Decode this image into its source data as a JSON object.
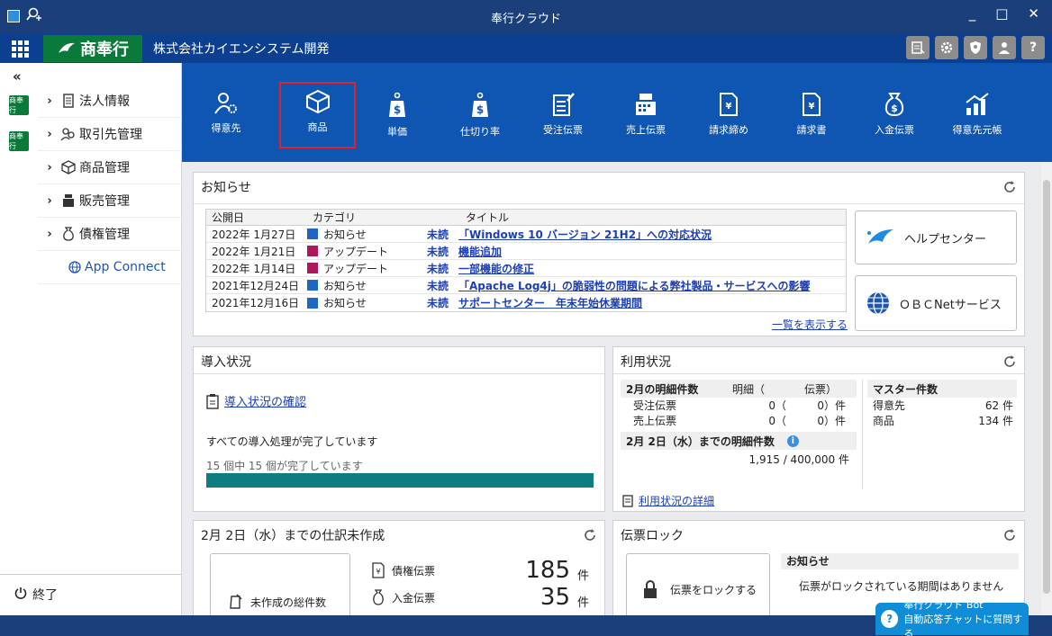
{
  "window": {
    "title": "奉行クラウド"
  },
  "header": {
    "brand": "商奉行",
    "company": "株式会社カイエンシステム開発"
  },
  "sidebar": {
    "apps": [
      {
        "label": "商奉行"
      },
      {
        "label": "商奉行"
      }
    ],
    "items": [
      {
        "label": "法人情報"
      },
      {
        "label": "取引先管理"
      },
      {
        "label": "商品管理"
      },
      {
        "label": "販売管理"
      },
      {
        "label": "債権管理"
      },
      {
        "label": "App Connect"
      }
    ],
    "exit_label": "終了"
  },
  "toolbar": {
    "items": [
      {
        "label": "得意先"
      },
      {
        "label": "商品",
        "selected": true
      },
      {
        "label": "単価"
      },
      {
        "label": "仕切り率"
      },
      {
        "label": "受注伝票"
      },
      {
        "label": "売上伝票"
      },
      {
        "label": "請求締め"
      },
      {
        "label": "請求書"
      },
      {
        "label": "入金伝票"
      },
      {
        "label": "得意先元帳"
      }
    ]
  },
  "news": {
    "title": "お知らせ",
    "columns": [
      "公開日",
      "カテゴリ",
      "タイトル"
    ],
    "rows": [
      {
        "date": "2022年 1月27日",
        "category": "お知らせ",
        "color": "#1e66c4",
        "status": "未読",
        "title": "「Windows 10 バージョン 21H2」への対応状況"
      },
      {
        "date": "2022年 1月21日",
        "category": "アップデート",
        "color": "#b0165e",
        "status": "未読",
        "title": "機能追加"
      },
      {
        "date": "2022年 1月14日",
        "category": "アップデート",
        "color": "#b0165e",
        "status": "未読",
        "title": "一部機能の修正"
      },
      {
        "date": "2021年12月24日",
        "category": "お知らせ",
        "color": "#1e66c4",
        "status": "未読",
        "title": "「Apache Log4j」の脆弱性の問題による弊社製品・サービスへの影響"
      },
      {
        "date": "2021年12月16日",
        "category": "お知らせ",
        "color": "#1e66c4",
        "status": "未読",
        "title": "サポートセンター　年末年始休業期間"
      }
    ],
    "show_all": "一覧を表示する",
    "help_center": "ヘルプセンター",
    "obc_net": "ＯＢＣNetサービス"
  },
  "intro": {
    "title": "導入状況",
    "check_link": "導入状況の確認",
    "done_text": "すべての導入処理が完了しています",
    "count_text": "15 個中 15 個が完了しています",
    "progress": 1.0
  },
  "usage": {
    "title": "利用状況",
    "detail_header": "2月の明細件数",
    "col_detail": "明細（",
    "col_slip": "伝票）",
    "rows": [
      {
        "label": "受注伝票",
        "detail": "0（",
        "slip": "0）件"
      },
      {
        "label": "売上伝票",
        "detail": "0（",
        "slip": "0）件"
      }
    ],
    "until_header": "2月 2日（水）までの明細件数",
    "until_value": "1,915 / 400,000 件",
    "master_header": "マスター件数",
    "masters": [
      {
        "label": "得意先",
        "value": "62 件"
      },
      {
        "label": "商品",
        "value": "134 件"
      }
    ],
    "detail_link": "利用状況の詳細"
  },
  "journal": {
    "title": "2月 2日（水）までの仕訳未作成",
    "total_label": "未作成の総件数",
    "items": [
      {
        "label": "債権伝票",
        "value": "185",
        "unit": "件"
      },
      {
        "label": "入金伝票",
        "value": "35",
        "unit": "件"
      }
    ]
  },
  "lock": {
    "title": "伝票ロック",
    "lock_button": "伝票をロックする",
    "notice_header": "お知らせ",
    "notice_text": "伝票がロックされている期間はありません"
  },
  "bot": {
    "line1": "奉行クラウド Bot",
    "line2": "自動応答チャットに質問する"
  },
  "colors": {
    "titlebar": "#1b3f7a",
    "header": "#0d3f91",
    "toolbar": "#0f56b3",
    "brand_green": "#0a7a3a",
    "selection": "#e0202a"
  }
}
